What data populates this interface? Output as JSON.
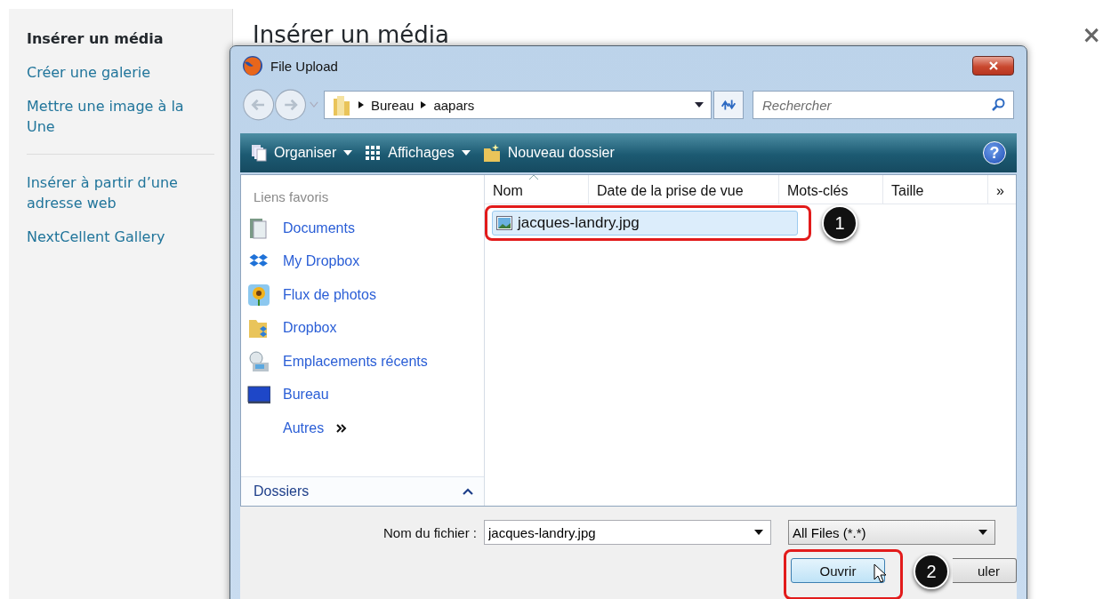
{
  "sidebar": {
    "groups": [
      [
        {
          "label": "Insérer un média",
          "selected": true
        },
        {
          "label": "Créer une galerie",
          "selected": false
        },
        {
          "label": "Mettre une image à la Une",
          "selected": false
        }
      ],
      [
        {
          "label": "Insérer à partir d’une adresse web",
          "selected": false
        },
        {
          "label": "NextCellent Gallery",
          "selected": false
        }
      ]
    ]
  },
  "main": {
    "title": "Insérer un média",
    "close": "×"
  },
  "dialog": {
    "title": "File Upload",
    "breadcrumb": [
      "Bureau",
      "aapars"
    ],
    "search": {
      "placeholder": "Rechercher"
    },
    "toolbar": [
      {
        "label": "Organiser",
        "kind": "menu"
      },
      {
        "label": "Affichages",
        "kind": "menu"
      },
      {
        "label": "Nouveau dossier",
        "kind": "action"
      }
    ],
    "help": "?",
    "favorites_title": "Liens favoris",
    "favorites": [
      {
        "label": "Documents",
        "kind": "link"
      },
      {
        "label": "My Dropbox",
        "kind": "link"
      },
      {
        "label": "Flux de photos",
        "kind": "link"
      },
      {
        "label": "Dropbox",
        "kind": "link"
      },
      {
        "label": "Emplacements récents",
        "kind": "link"
      },
      {
        "label": "Bureau",
        "kind": "link"
      },
      {
        "label": "Autres",
        "kind": "more"
      }
    ],
    "folders_label": "Dossiers",
    "columns": [
      "Nom",
      "Date de la prise de vue",
      "Mots-clés",
      "Taille",
      "»"
    ],
    "files": [
      {
        "name": "jacques-landry.jpg",
        "selected": true,
        "callout": "1"
      }
    ],
    "filename": {
      "label": "Nom du fichier :",
      "value": "jacques-landry.jpg"
    },
    "filetype": "All Files (*.*)",
    "buttons": [
      {
        "label": "Ouvrir",
        "kind": "primary",
        "callout": "2"
      },
      {
        "label": "uler",
        "kind": "secondary"
      }
    ]
  }
}
